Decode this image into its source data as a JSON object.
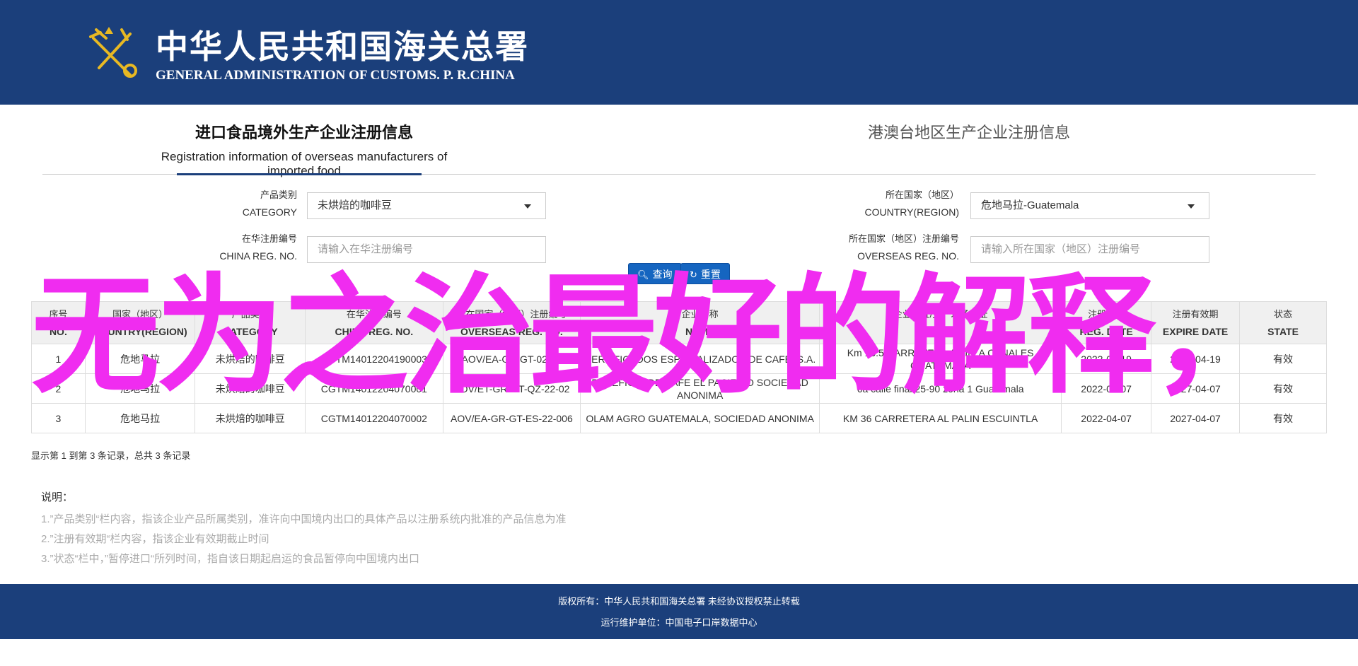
{
  "header": {
    "brand_cn": "中华人民共和国海关总署",
    "brand_en": "GENERAL ADMINISTRATION OF CUSTOMS. P. R.CHINA"
  },
  "tabs": [
    {
      "cn": "进口食品境外生产企业注册信息",
      "en": "Registration information of overseas manufacturers of imported food"
    },
    {
      "cn": "港澳台地区生产企业注册信息"
    }
  ],
  "form": {
    "category_label_cn": "产品类别",
    "category_label_en": "CATEGORY",
    "category_value": "未烘焙的咖啡豆",
    "country_label_cn": "所在国家（地区）",
    "country_label_en": "COUNTRY(REGION)",
    "country_value": "危地马拉-Guatemala",
    "china_reg_label_cn": "在华注册编号",
    "china_reg_label_en": "CHINA REG. NO.",
    "china_reg_placeholder": "请输入在华注册编号",
    "overseas_reg_label_cn": "所在国家（地区）注册编号",
    "overseas_reg_label_en": "OVERSEAS REG. NO.",
    "overseas_reg_placeholder": "请输入所在国家（地区）注册编号",
    "search_label": "查询",
    "reset_label": "重置"
  },
  "table": {
    "headers": [
      {
        "cn": "序号",
        "en": "NO."
      },
      {
        "cn": "国家（地区）",
        "en": "COUNTRY(REGION)"
      },
      {
        "cn": "产品类别",
        "en": "CATEGORY"
      },
      {
        "cn": "在华注册编号",
        "en": "CHINA REG. NO."
      },
      {
        "cn": "所在国家（地区）注册编号",
        "en": "OVERSEAS REG. NO."
      },
      {
        "cn": "企业名称",
        "en": "NAME"
      },
      {
        "cn": "企业地址/生产现场地址",
        "en": "ADDRESS"
      },
      {
        "cn": "注册日期",
        "en": "REG. DATE"
      },
      {
        "cn": "注册有效期",
        "en": "EXPIRE DATE"
      },
      {
        "cn": "状态",
        "en": "STATE"
      }
    ],
    "rows": [
      [
        "1",
        "危地马拉",
        "未烘焙的咖啡豆",
        "CGTM14012204190003",
        "AOV/EA-GR-GT-02-01",
        "CERTIFICADOS ESPECIALIZADOS DE CAFE, S.A.",
        "Km 15.5 CARRETERA A VILLA CANALES GUATEMALA",
        "2022-04-19",
        "2027-04-19",
        "有效"
      ],
      [
        "2",
        "危地马拉",
        "未烘焙的咖啡豆",
        "CGTM14012204070001",
        "AOV/ET-GR-GT-QZ-22-02",
        "BENEFICIO DE CAFE EL PACIFICO SOCIEDAD ANONIMA",
        "6a calle final 25-90 zona 1 Guatemala",
        "2022-04-07",
        "2027-04-07",
        "有效"
      ],
      [
        "3",
        "危地马拉",
        "未烘焙的咖啡豆",
        "CGTM14012204070002",
        "AOV/EA-GR-GT-ES-22-006",
        "OLAM AGRO GUATEMALA, SOCIEDAD ANONIMA",
        "KM 36 CARRETERA AL PALIN ESCUINTLA",
        "2022-04-07",
        "2027-04-07",
        "有效"
      ]
    ]
  },
  "pagination_info": "显示第 1 到第 3 条记录，总共 3 条记录",
  "notes": {
    "title": "说明：",
    "items": [
      "1.”产品类别“栏内容，指该企业产品所属类别，准许向中国境内出口的具体产品以注册系统内批准的产品信息为准",
      "2.”注册有效期“栏内容，指该企业有效期截止时间",
      "3.”状态“栏中，”暂停进口“所列时间，指自该日期起启运的食品暂停向中国境内出口"
    ]
  },
  "overlay_text": "无为之治最好的解释，",
  "footer": {
    "line1": "版权所有：中华人民共和国海关总署 未经协议授权禁止转载",
    "line2": "运行维护单位：中国电子口岸数据中心"
  },
  "colors": {
    "brand_blue": "#1b3f7b",
    "button_blue": "#1565c0",
    "overlay_magenta": "#f02cf0"
  }
}
